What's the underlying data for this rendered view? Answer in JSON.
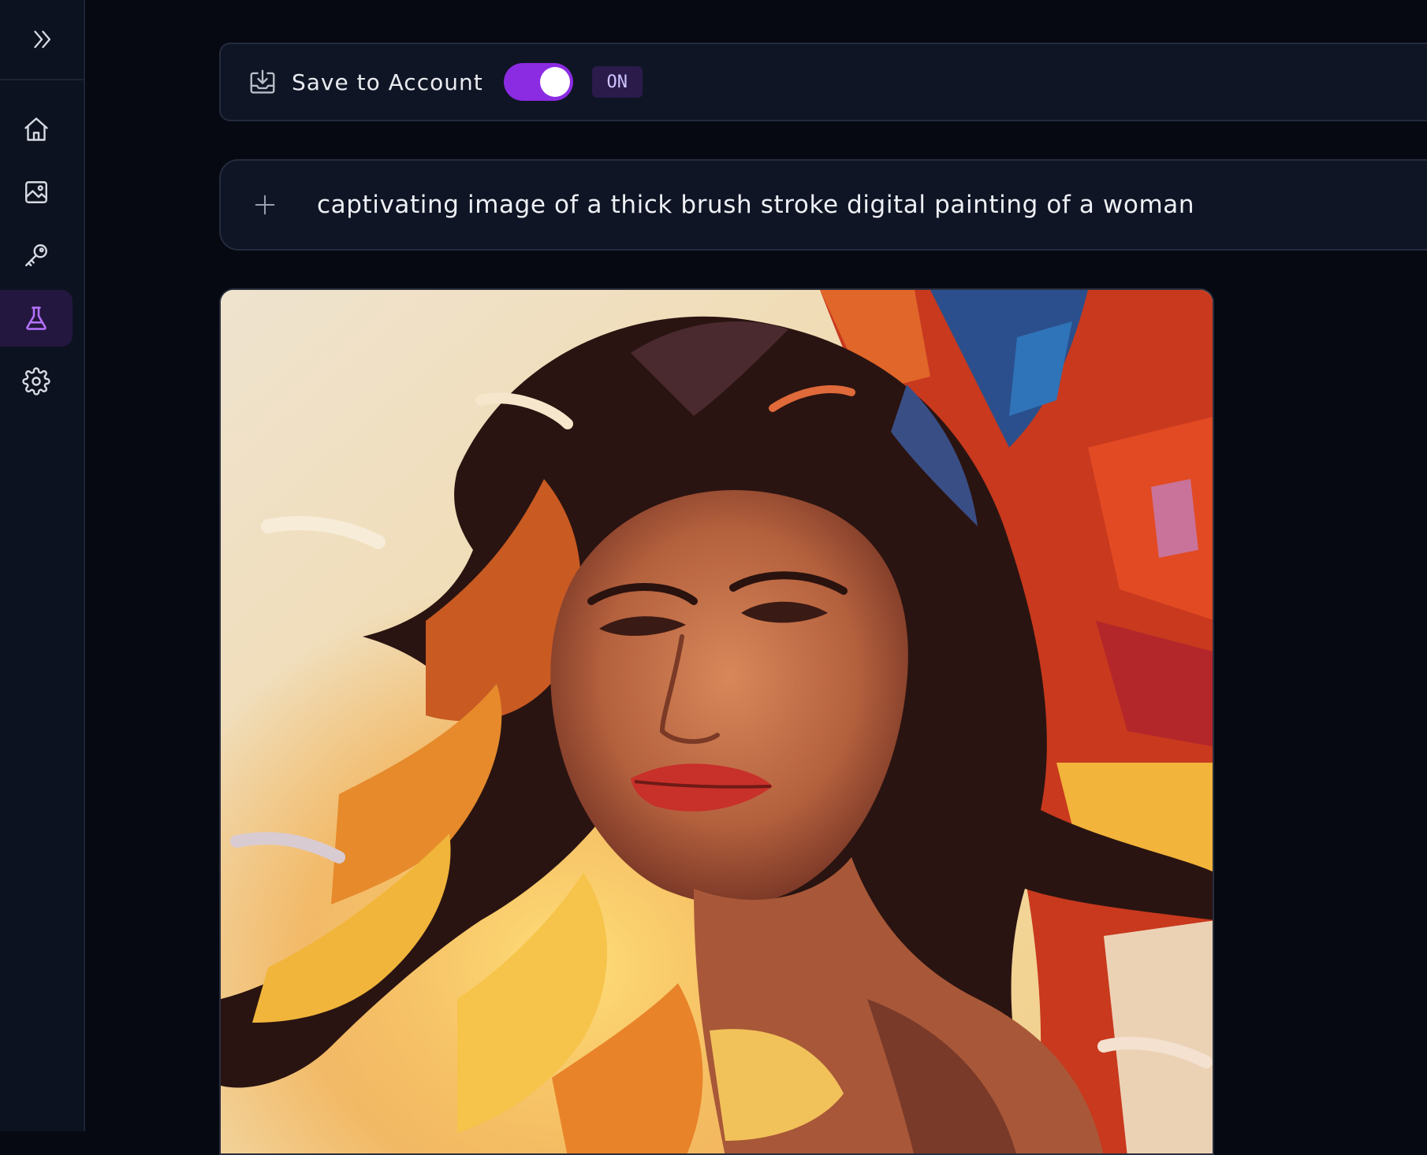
{
  "sidebar": {
    "expand_icon": "chevrons-right-icon",
    "items": [
      {
        "name": "home",
        "icon": "home-icon",
        "active": false
      },
      {
        "name": "images",
        "icon": "image-icon",
        "active": false
      },
      {
        "name": "api-keys",
        "icon": "key-icon",
        "active": false
      },
      {
        "name": "lab",
        "icon": "flask-icon",
        "active": true
      },
      {
        "name": "settings",
        "icon": "gear-icon",
        "active": false
      }
    ]
  },
  "save_bar": {
    "icon": "download-tray-icon",
    "label": "Save to Account",
    "toggle_on": true,
    "status": "ON"
  },
  "prompt": {
    "icon": "plus-icon",
    "text": "captivating image of a thick brush stroke digital painting of a woman"
  },
  "result": {
    "image_alt": "brush stroke digital painting of a woman with flowing dark hair"
  },
  "colors": {
    "background": "#060912",
    "sidebar": "#0d1220",
    "accent": "#8b2be2",
    "active_nav": "#24173f"
  }
}
